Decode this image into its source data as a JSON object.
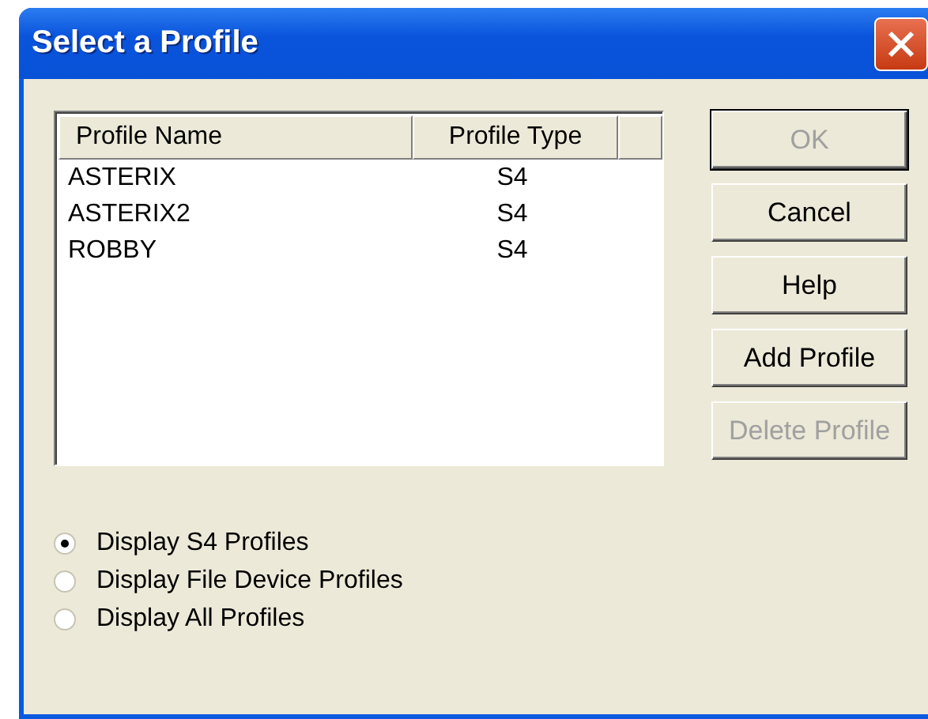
{
  "window": {
    "title": "Select a Profile"
  },
  "table": {
    "columns": [
      "Profile Name",
      "Profile Type"
    ],
    "rows": [
      {
        "name": "ASTERIX",
        "type": "S4"
      },
      {
        "name": "ASTERIX2",
        "type": "S4"
      },
      {
        "name": "ROBBY",
        "type": "S4"
      }
    ]
  },
  "buttons": [
    {
      "label": "OK",
      "disabled": true,
      "default": true
    },
    {
      "label": "Cancel",
      "disabled": false,
      "default": false
    },
    {
      "label": "Help",
      "disabled": false,
      "default": false
    },
    {
      "label": "Add Profile",
      "disabled": false,
      "default": false
    },
    {
      "label": "Delete Profile",
      "disabled": true,
      "default": false
    }
  ],
  "options": [
    {
      "label": "Display S4 Profiles",
      "selected": true
    },
    {
      "label": "Display File Device Profiles",
      "selected": false
    },
    {
      "label": "Display All Profiles",
      "selected": false
    }
  ]
}
